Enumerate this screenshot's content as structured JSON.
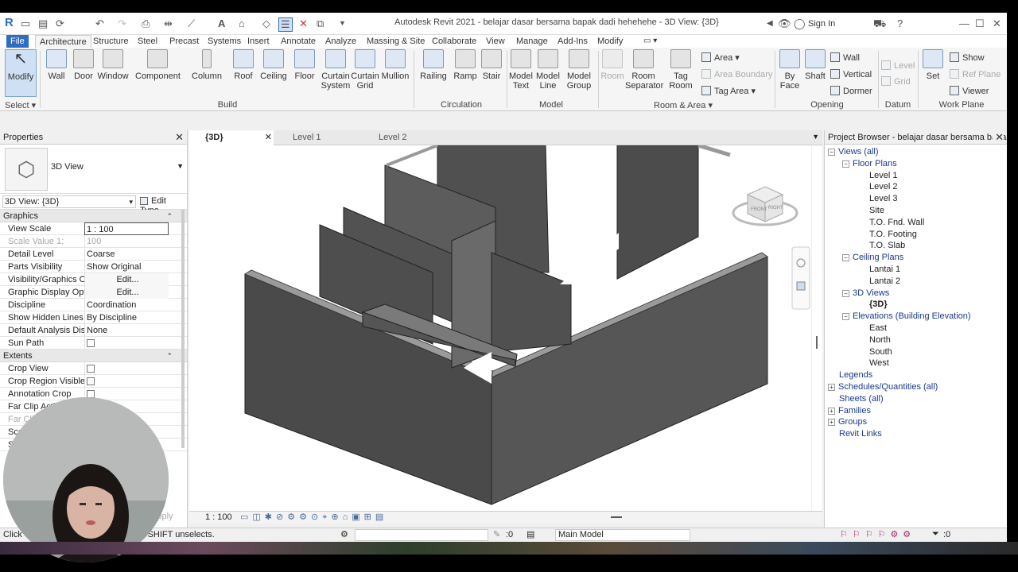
{
  "app": {
    "title": "Autodesk Revit 2021 - belajar dasar bersama bapak dadi hehehehe - 3D View: {3D}",
    "sign_in": "Sign In"
  },
  "ribbon": {
    "tabs": [
      "File",
      "Architecture",
      "Structure",
      "Steel",
      "Precast",
      "Systems",
      "Insert",
      "Annotate",
      "Analyze",
      "Massing & Site",
      "Collaborate",
      "View",
      "Manage",
      "Add-Ins",
      "Modify"
    ],
    "select_label": "Select",
    "modify": "Modify",
    "build": {
      "label": "Build",
      "wall": "Wall",
      "door": "Door",
      "window": "Window",
      "component": "Component",
      "column": "Column",
      "roof": "Roof",
      "ceiling": "Ceiling",
      "floor": "Floor",
      "curtain_system": "Curtain System",
      "curtain_grid": "Curtain Grid",
      "mullion": "Mullion"
    },
    "circulation": {
      "label": "Circulation",
      "railing": "Railing",
      "ramp": "Ramp",
      "stair": "Stair"
    },
    "model": {
      "label": "Model",
      "model_text": "Model Text",
      "model_line": "Model Line",
      "model_group": "Model Group"
    },
    "room_area": {
      "label": "Room & Area",
      "room": "Room",
      "room_separator": "Room Separator",
      "tag_room": "Tag Room",
      "area": "Area",
      "area_boundary": "Area Boundary",
      "tag_area": "Tag Area"
    },
    "opening": {
      "label": "Opening",
      "by_face": "By Face",
      "shaft": "Shaft",
      "wall": "Wall",
      "vertical": "Vertical",
      "dormer": "Dormer"
    },
    "datum": {
      "label": "Datum",
      "level": "Level",
      "grid": "Grid"
    },
    "work_plane": {
      "label": "Work Plane",
      "set": "Set",
      "show": "Show",
      "ref_plane": "Ref Plane",
      "viewer": "Viewer"
    }
  },
  "properties": {
    "title": "Properties",
    "type_name": "3D View",
    "instance": "3D View: {3D}",
    "edit_type": "Edit Type",
    "graphics_label": "Graphics",
    "graphics": [
      {
        "k": "View Scale",
        "v": "1 : 100",
        "style": "boxed"
      },
      {
        "k": "Scale Value    1:",
        "v": "100",
        "style": "dim"
      },
      {
        "k": "Detail Level",
        "v": "Coarse"
      },
      {
        "k": "Parts Visibility",
        "v": "Show Original"
      },
      {
        "k": "Visibility/Graphics O...",
        "v": "Edit...",
        "style": "btn"
      },
      {
        "k": "Graphic Display Opt...",
        "v": "Edit...",
        "style": "btn"
      },
      {
        "k": "Discipline",
        "v": "Coordination"
      },
      {
        "k": "Show Hidden Lines",
        "v": "By Discipline"
      },
      {
        "k": "Default Analysis Dis...",
        "v": "None"
      },
      {
        "k": "Sun Path",
        "v": "",
        "style": "check"
      }
    ],
    "extents_label": "Extents",
    "extents": [
      {
        "k": "Crop View",
        "v": "",
        "style": "check"
      },
      {
        "k": "Crop Region Visible",
        "v": "",
        "style": "check"
      },
      {
        "k": "Annotation Crop",
        "v": "",
        "style": "check"
      },
      {
        "k": "Far Clip Active",
        "v": ""
      },
      {
        "k": "Far Clip",
        "v": "",
        "style": "dim"
      },
      {
        "k": "Scop",
        "v": ""
      },
      {
        "k": "Se",
        "v": ""
      }
    ],
    "apply": "Apply"
  },
  "doc_tabs": [
    "{3D}",
    "Level 1",
    "Level 2"
  ],
  "view_bar": {
    "scale": "1 : 100"
  },
  "browser": {
    "title": "Project Browser - belajar dasar bersama bapa...",
    "views_all": "Views (all)",
    "floor_plans": "Floor Plans",
    "floor_plan_items": [
      "Level 1",
      "Level 2",
      "Level 3",
      "Site",
      "T.O. Fnd. Wall",
      "T.O. Footing",
      "T.O. Slab"
    ],
    "ceiling_plans": "Ceiling Plans",
    "ceiling_items": [
      "Lantai 1",
      "Lantai 2"
    ],
    "views_3d": "3D Views",
    "views_3d_items": [
      "{3D}"
    ],
    "elevations": "Elevations (Building Elevation)",
    "elevation_items": [
      "East",
      "North",
      "South",
      "West"
    ],
    "legends": "Legends",
    "schedules": "Schedules/Quantities (all)",
    "sheets": "Sheets (all)",
    "families": "Families",
    "groups": "Groups",
    "revit_links": "Revit Links"
  },
  "status": {
    "text": "Click",
    "text2": "ds, SHIFT unselects.",
    "zero1": ":0",
    "main_model": "Main Model",
    "zero2": ":0"
  },
  "viewcube": {
    "front": "FRONT",
    "right": "RIGHT"
  }
}
